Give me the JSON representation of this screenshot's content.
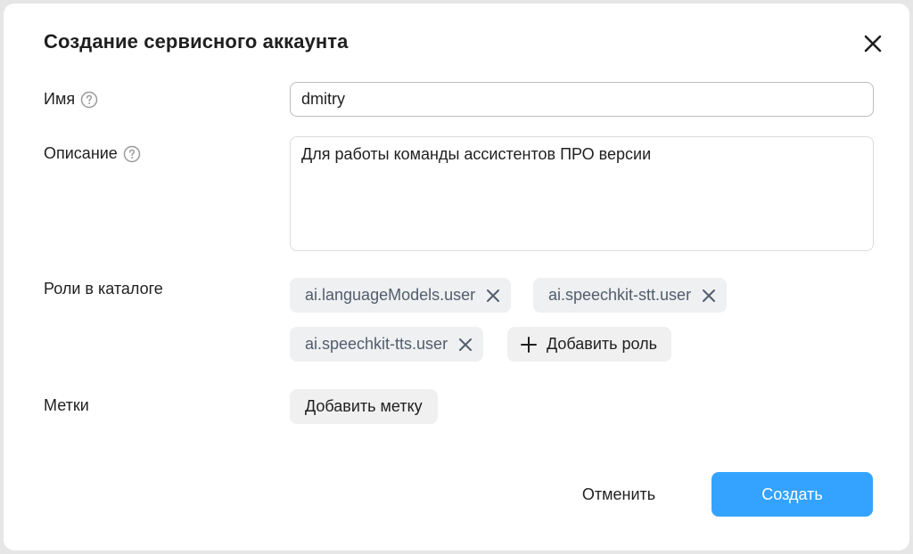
{
  "dialog": {
    "title": "Создание сервисного аккаунта",
    "close_icon": "close-icon"
  },
  "fields": {
    "name": {
      "label": "Имя",
      "value": "dmitry"
    },
    "description": {
      "label": "Описание",
      "value": "Для работы команды ассистентов ПРО версии"
    },
    "roles": {
      "label": "Роли в каталоге",
      "items": [
        {
          "label": "ai.languageModels.user"
        },
        {
          "label": "ai.speechkit-stt.user"
        },
        {
          "label": "ai.speechkit-tts.user"
        }
      ],
      "add_label": "Добавить роль"
    },
    "tags": {
      "label": "Метки",
      "add_label": "Добавить метку"
    }
  },
  "actions": {
    "cancel_label": "Отменить",
    "create_label": "Создать"
  },
  "colors": {
    "primary": "#33a3ff",
    "chip_bg": "#eef0f2",
    "chip_text": "#525d6c"
  }
}
